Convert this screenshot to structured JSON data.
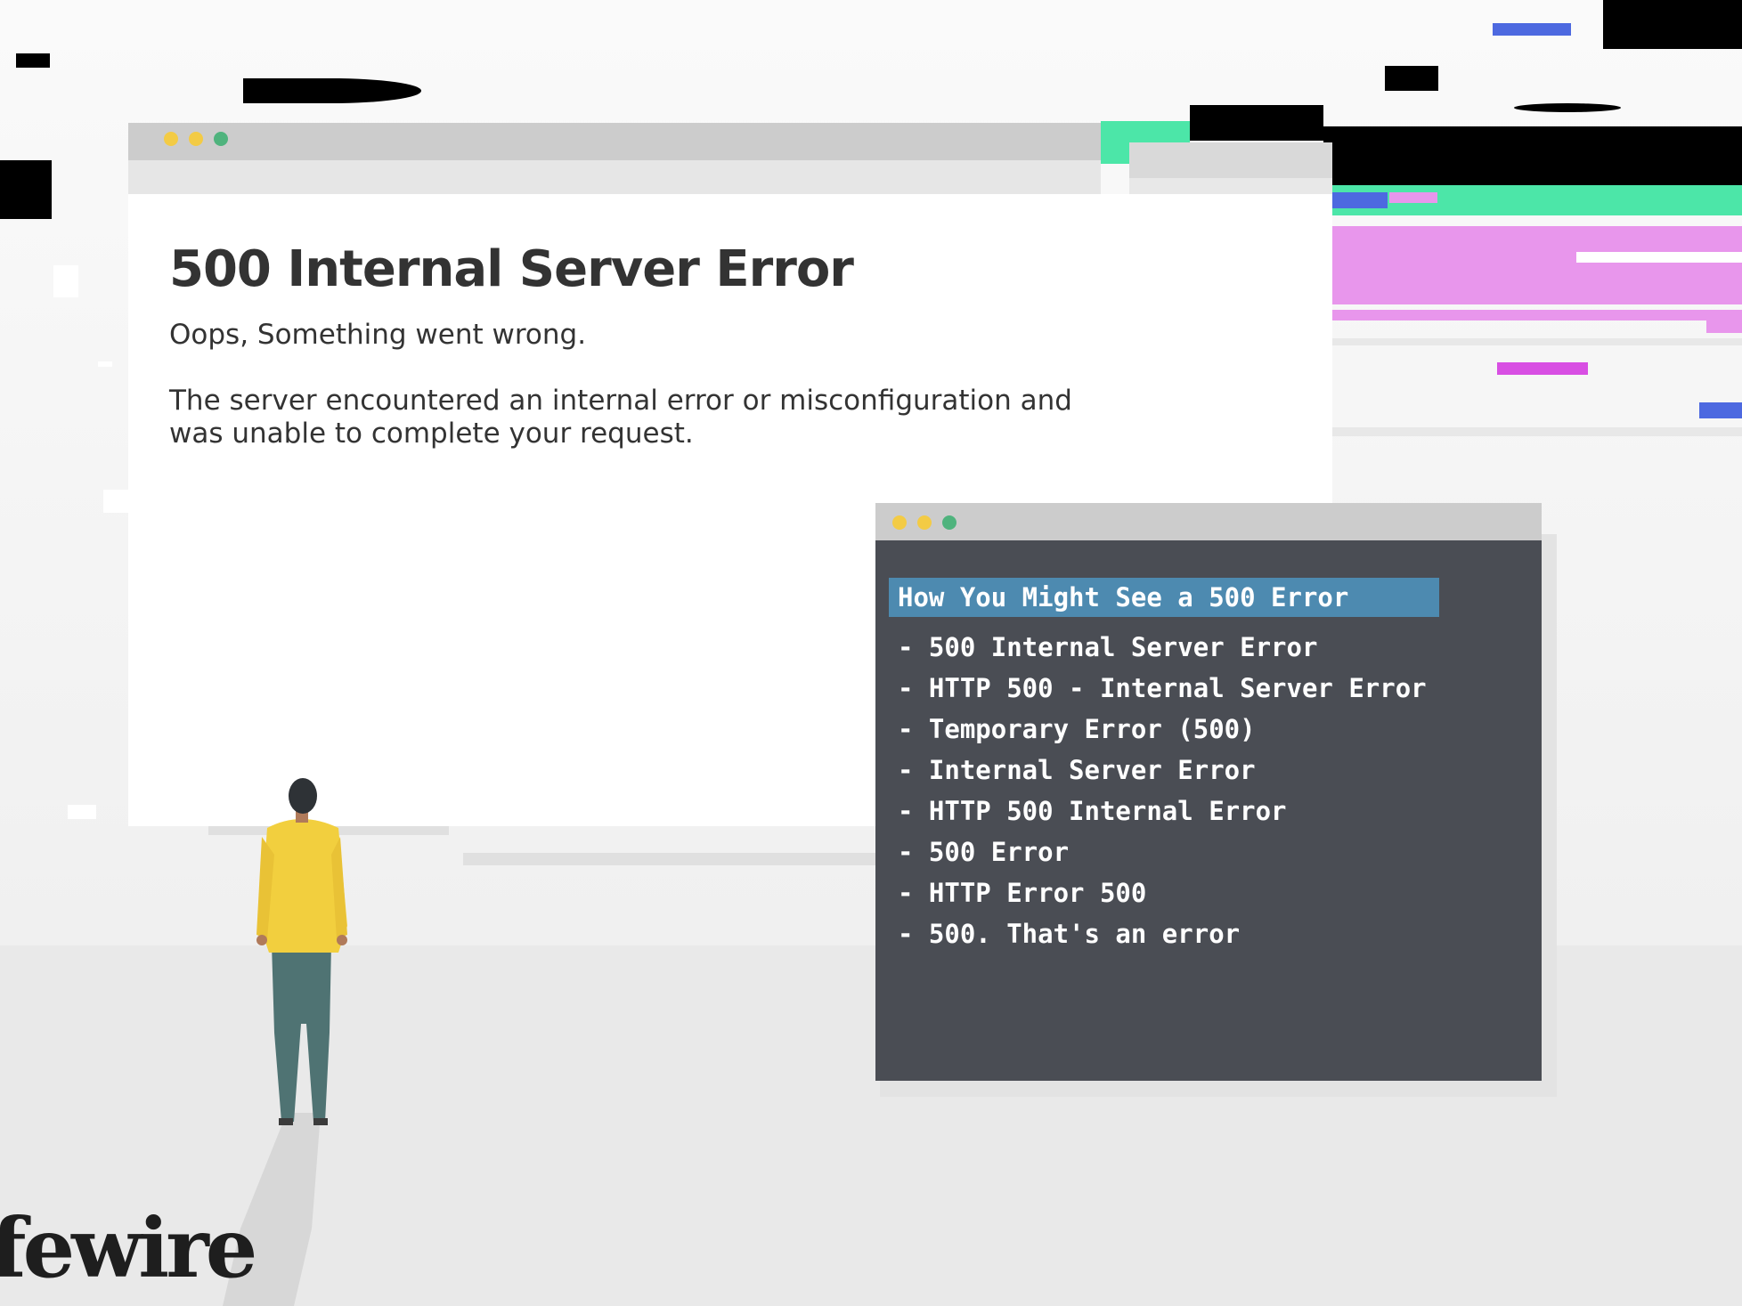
{
  "browser": {
    "window_controls": [
      "yellow-dot",
      "yellow-dot",
      "green-dot"
    ],
    "error_title": "500 Internal Server Error",
    "error_subtitle": "Oops, Something went wrong.",
    "error_description": "The server encountered an internal error or misconfiguration and was unable to complete your request."
  },
  "terminal": {
    "window_controls": [
      "yellow-dot",
      "yellow-dot",
      "green-dot"
    ],
    "heading": "How You Might See a 500 Error",
    "items": [
      "- 500 Internal Server Error",
      "- HTTP 500 - Internal Server Error",
      "- Temporary Error (500)",
      "- Internal Server Error",
      "- HTTP 500 Internal Error",
      "- 500 Error",
      "- HTTP Error 500",
      "- 500. That's an error"
    ]
  },
  "logo_text": "fewire",
  "colors": {
    "terminal_bg": "#4a4d54",
    "terminal_heading_bg": "#4d8ab0",
    "glitch_teal": "#4ce6a8",
    "glitch_blue": "#4d69e0",
    "glitch_pink": "#e896ec",
    "person_sweater": "#f2cf3e",
    "person_pants": "#4f7373"
  }
}
